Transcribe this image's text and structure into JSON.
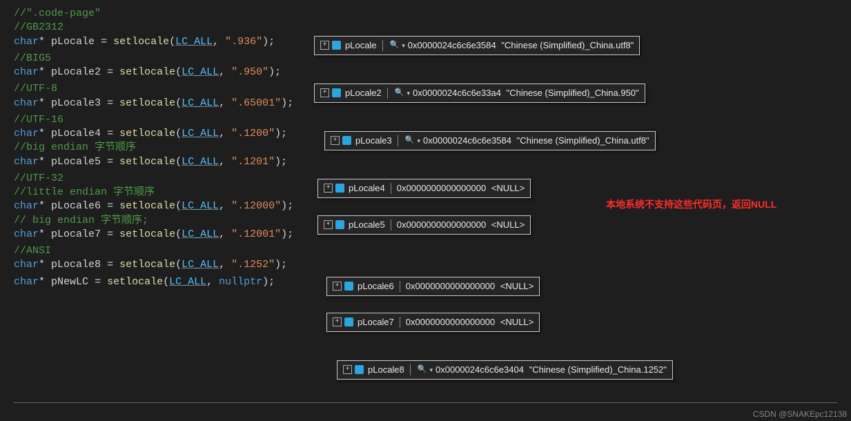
{
  "code": {
    "c_codepage": "//\".code-page\"",
    "c_gb2312": "//GB2312",
    "l_pLocale": {
      "kw": "char",
      "star": "*",
      "id": "pLocale",
      "eq": " = ",
      "fn": "setlocale",
      "lp": "(",
      "enum": "LC_ALL",
      "comma": ", ",
      "str": "\".936\"",
      "rp": ");"
    },
    "c_big5": "//BIG5",
    "l_pLocale2": {
      "kw": "char",
      "star": "*",
      "id": "pLocale2",
      "eq": " = ",
      "fn": "setlocale",
      "lp": "(",
      "enum": "LC_ALL",
      "comma": ", ",
      "str": "\".950\"",
      "rp": ");"
    },
    "c_utf8": "//UTF-8",
    "l_pLocale3": {
      "kw": "char",
      "star": "*",
      "id": "pLocale3",
      "eq": " = ",
      "fn": "setlocale",
      "lp": "(",
      "enum": "LC_ALL",
      "comma": ", ",
      "str": "\".65001\"",
      "rp": ");"
    },
    "c_utf16": "//UTF-16",
    "l_pLocale4": {
      "kw": "char",
      "star": "*",
      "id": "pLocale4",
      "eq": " = ",
      "fn": "setlocale",
      "lp": "(",
      "enum": "LC_ALL",
      "comma": ", ",
      "str": "\".1200\"",
      "rp": ");"
    },
    "c_bigendian1": "//big endian 字节顺序",
    "l_pLocale5": {
      "kw": "char",
      "star": "*",
      "id": "pLocale5",
      "eq": " = ",
      "fn": "setlocale",
      "lp": "(",
      "enum": "LC_ALL",
      "comma": ", ",
      "str": "\".1201\"",
      "rp": ");"
    },
    "c_utf32": "//UTF-32",
    "c_littleendian": "//little endian 字节顺序",
    "l_pLocale6": {
      "kw": "char",
      "star": "*",
      "id": "pLocale6",
      "eq": " = ",
      "fn": "setlocale",
      "lp": "(",
      "enum": "LC_ALL",
      "comma": ", ",
      "str": "\".12000\"",
      "rp": ");"
    },
    "c_bigendian2": "// big endian 字节顺序;",
    "l_pLocale7": {
      "kw": "char",
      "star": "*",
      "id": "pLocale7",
      "eq": " = ",
      "fn": "setlocale",
      "lp": "(",
      "enum": "LC_ALL",
      "comma": ", ",
      "str": "\".12001\"",
      "rp": ");"
    },
    "c_ansi": "//ANSI",
    "l_pLocale8": {
      "kw": "char",
      "star": "*",
      "id": "pLocale8",
      "eq": " = ",
      "fn": "setlocale",
      "lp": "(",
      "enum": "LC_ALL",
      "comma": ", ",
      "str": "\".1252\"",
      "rp": ");"
    },
    "l_pNewLC": {
      "kw": "char",
      "star": "*",
      "id": "pNewLC",
      "eq": " = ",
      "fn": "setlocale",
      "lp": "(",
      "enum": "LC_ALL",
      "comma": ", ",
      "null": "nullptr",
      "rp": ");"
    }
  },
  "tips": {
    "t1": {
      "var": "pLocale",
      "mag": true,
      "addr": "0x0000024c6c6e3584",
      "str": "\"Chinese (Simplified)_China.utf8\""
    },
    "t2": {
      "var": "pLocale2",
      "mag": true,
      "addr": "0x0000024c6c6e33a4",
      "str": "\"Chinese (Simplified)_China.950\""
    },
    "t3": {
      "var": "pLocale3",
      "mag": true,
      "addr": "0x0000024c6c6e3584",
      "str": "\"Chinese (Simplified)_China.utf8\""
    },
    "t4": {
      "var": "pLocale4",
      "mag": false,
      "addr": "0x0000000000000000",
      "str": "<NULL>"
    },
    "t5": {
      "var": "pLocale5",
      "mag": false,
      "addr": "0x0000000000000000",
      "str": "<NULL>"
    },
    "t6": {
      "var": "pLocale6",
      "mag": false,
      "addr": "0x0000000000000000",
      "str": "<NULL>"
    },
    "t7": {
      "var": "pLocale7",
      "mag": false,
      "addr": "0x0000000000000000",
      "str": "<NULL>"
    },
    "t8": {
      "var": "pLocale8",
      "mag": true,
      "addr": "0x0000024c6c6e3404",
      "str": "\"Chinese (Simplified)_China.1252\""
    }
  },
  "annotation": "本地系统不支持这些代码页，返回NULL",
  "watermark": "CSDN @SNAKEpc12138"
}
